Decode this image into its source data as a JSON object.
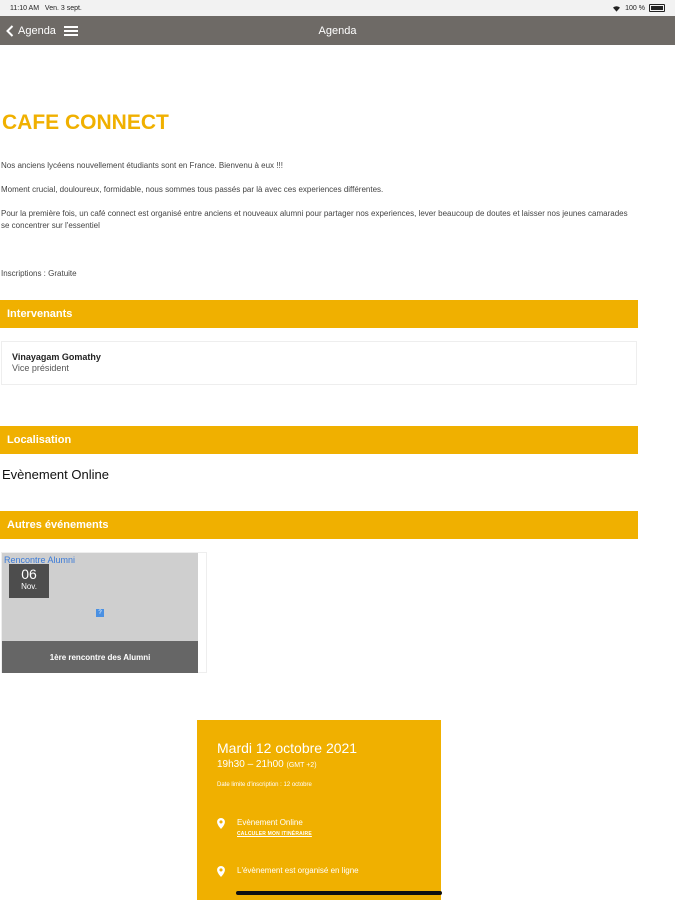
{
  "status": {
    "time": "11:10 AM",
    "date": "Ven. 3 sept.",
    "battery": "100 %"
  },
  "nav": {
    "back_label": "Agenda",
    "title": "Agenda"
  },
  "event": {
    "title": "CAFE CONNECT",
    "paragraphs": [
      "Nos anciens lycéens nouvellement étudiants sont en France. Bienvenu à eux !!!",
      "Moment crucial, douloureux, formidable, nous sommes tous passés par là avec ces experiences différentes.",
      "Pour la première fois, un café connect est organisé entre anciens et nouveaux alumni pour partager nos experiences, lever beaucoup de doutes et laisser nos jeunes camarades se concentrer sur l'essentiel",
      "Inscriptions : Gratuite"
    ]
  },
  "sections": {
    "speakers": "Intervenants",
    "location": "Localisation",
    "other_events": "Autres événements"
  },
  "speaker": {
    "name": "Vinayagam Gomathy",
    "role": "Vice président"
  },
  "location": {
    "text": "Evènement Online"
  },
  "other_event": {
    "link": "Rencontre Alumni",
    "day": "06",
    "month": "Nov.",
    "title": "1ère rencontre des Alumni",
    "broken_image": "?"
  },
  "info": {
    "date": "Mardi 12 octobre 2021",
    "time": "19h30 – 21h00",
    "timezone": "(GMT +2)",
    "deadline": "Date limite d'inscription : 12 octobre",
    "location": "Evènement Online",
    "directions": "CALCULER MON ITINÉRAIRE",
    "online_note": "L'évènement est organisé en ligne"
  }
}
